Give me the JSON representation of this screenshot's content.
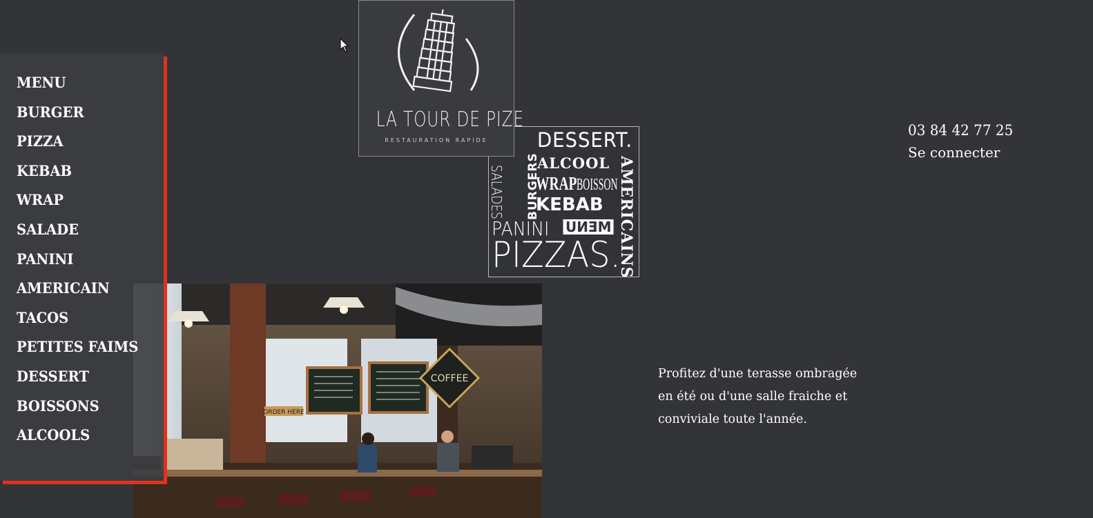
{
  "logo": {
    "title": "LA TOUR DE PIZE",
    "subtitle": "RESTAURATION RAPIDE",
    "icon": "leaning-tower-icon"
  },
  "collage": {
    "words": {
      "dessert": "DESSERT.",
      "alcool": "ALCOOL",
      "wrap": "WRAP",
      "boisson": "BOISSON",
      "kebab": "KEBAB",
      "panini": "PANINI",
      "menu": "MENU",
      "pizzas": "PIZZAS.",
      "salades": "SALADES",
      "burgers": "BURGERS",
      "americains": "AMERICAINS"
    }
  },
  "side_menu": {
    "items": [
      {
        "label": "MENU"
      },
      {
        "label": "BURGER"
      },
      {
        "label": "PIZZA"
      },
      {
        "label": "KEBAB"
      },
      {
        "label": "WRAP"
      },
      {
        "label": "SALADE"
      },
      {
        "label": "PANINI"
      },
      {
        "label": "AMERICAIN"
      },
      {
        "label": "TACOS"
      },
      {
        "label": "PETITES FAIMS"
      },
      {
        "label": "DESSERT"
      },
      {
        "label": "BOISSONS"
      },
      {
        "label": "ALCOOLS"
      }
    ],
    "accent_color": "#e2321c"
  },
  "contact": {
    "phone": "03 84 42 77 25",
    "login_label": "Se connecter"
  },
  "photo": {
    "signs": {
      "coffee": "COFFEE",
      "order_here": "ORDER HERE"
    }
  },
  "terrace": {
    "lines": [
      "Profitez d'une terasse ombragée",
      "en été ou d'une salle fraiche et",
      "conviviale toute l'année."
    ]
  },
  "colors": {
    "background": "#333438",
    "menu_background": "#3c3d40",
    "accent": "#e2321c",
    "text": "#ffffff"
  }
}
